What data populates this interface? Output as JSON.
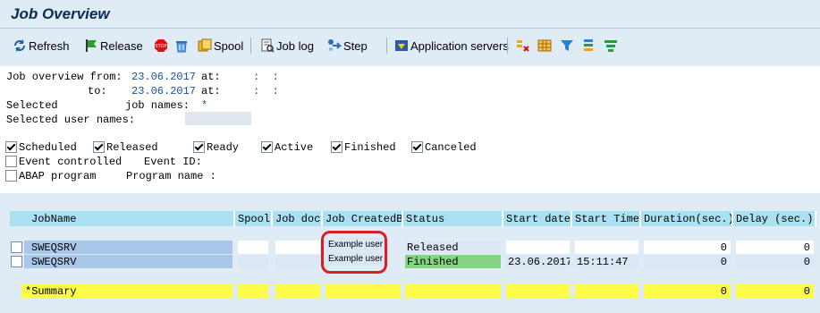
{
  "title": "Job Overview",
  "toolbar": {
    "refresh": "Refresh",
    "release": "Release",
    "spool": "Spool",
    "job_log": "Job log",
    "step": "Step",
    "app_servers": "Application servers",
    "icons": [
      "refresh-icon",
      "flag-icon",
      "stop-icon",
      "trash-icon",
      "spool-icon",
      "job-log-icon",
      "step-icon",
      "app-servers-icon",
      "layout-icon",
      "grid-icon",
      "filter-icon",
      "sort-icon",
      "sum-icon"
    ]
  },
  "selection": {
    "from_label": "Job overview from:",
    "from_date": "23.06.2017",
    "at_label": "at:",
    "from_time": ":  :",
    "to_label": "to:",
    "to_date": "23.06.2017",
    "to_time": ":  :",
    "selected_label": "Selected",
    "job_names_label": "job names:",
    "job_names_value": "*",
    "user_names_label": "Selected user names:",
    "user_names_value": ""
  },
  "status_filters": {
    "scheduled": {
      "label": "Scheduled",
      "checked": true
    },
    "released": {
      "label": "Released",
      "checked": true
    },
    "ready": {
      "label": "Ready",
      "checked": true
    },
    "active": {
      "label": "Active",
      "checked": true
    },
    "finished": {
      "label": "Finished",
      "checked": true
    },
    "canceled": {
      "label": "Canceled",
      "checked": true
    },
    "event_controlled": {
      "label": "Event controlled",
      "checked": false
    },
    "event_id_label": "Event ID:",
    "abap_program": {
      "label": "ABAP program",
      "checked": false
    },
    "program_name_label": "Program name :"
  },
  "table": {
    "headers": [
      "JobName",
      "Spool",
      "Job doc",
      "Job CreatedB",
      "Status",
      "Start date",
      "Start Time",
      "Duration(sec.)",
      "Delay (sec.)"
    ],
    "rows": [
      {
        "job_name": "SWEQSRV",
        "spool": "",
        "job_doc": "",
        "created_by": "Example user",
        "status": "Released",
        "start_date": "",
        "start_time": "",
        "duration": "0",
        "delay": "0"
      },
      {
        "job_name": "SWEQSRV",
        "spool": "",
        "job_doc": "",
        "created_by": "Example user",
        "status": "Finished",
        "start_date": "23.06.2017",
        "start_time": "15:11:47",
        "duration": "0",
        "delay": "0"
      }
    ],
    "summary": {
      "label": "*Summary",
      "duration": "0",
      "delay": "0"
    }
  },
  "colors": {
    "header": "#a9e1f2",
    "summary": "#fffb49",
    "finished": "#84d581",
    "highlight": "#e01b24"
  }
}
